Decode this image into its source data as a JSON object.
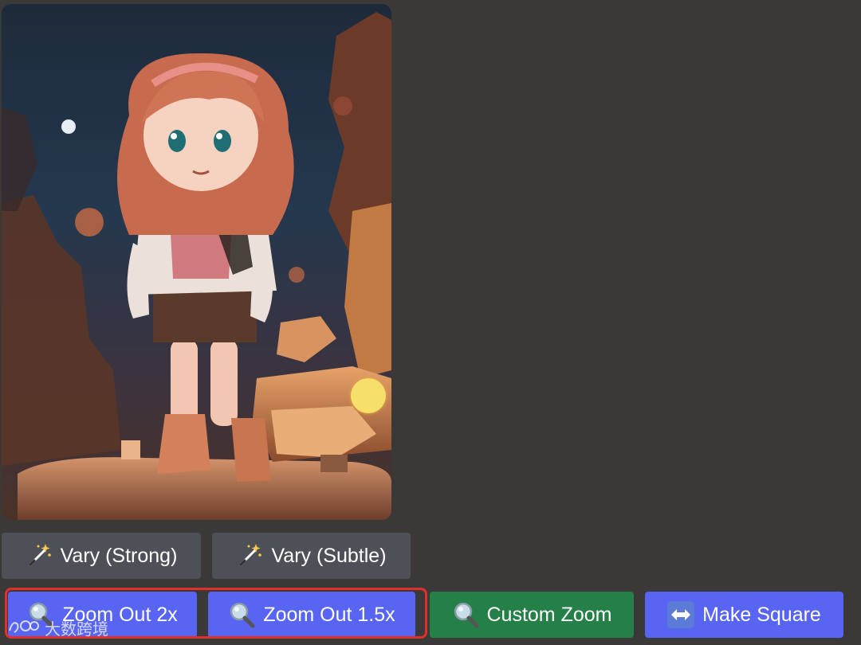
{
  "buttons": {
    "vary_strong": "Vary (Strong)",
    "vary_subtle": "Vary (Subtle)",
    "zoom_out_2x": "Zoom Out 2x",
    "zoom_out_1_5x": "Zoom Out 1.5x",
    "custom_zoom": "Custom Zoom",
    "make_square": "Make Square"
  },
  "watermark": {
    "text": "大数跨境"
  },
  "colors": {
    "background": "#3a3938",
    "button_gray": "#4e5058",
    "button_blurple": "#5865f2",
    "button_green": "#248046",
    "highlight": "#e0302c"
  },
  "icons": {
    "vary": "magic-wand-icon",
    "zoom": "magnifier-icon",
    "square": "left-right-arrow-icon"
  }
}
